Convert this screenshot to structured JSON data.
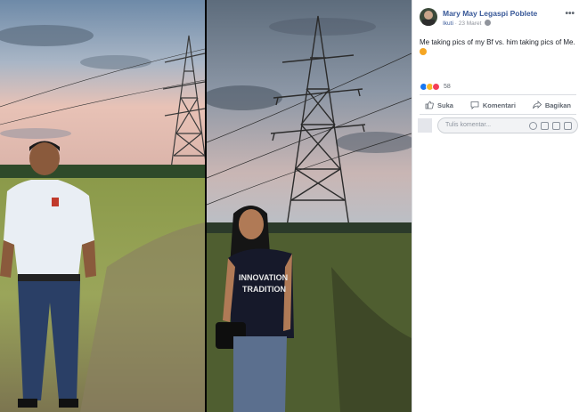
{
  "post": {
    "author": "Mary May Legaspi Poblete",
    "follow": "Ikuti",
    "date": "23 Maret",
    "caption": "Me taking pics of my Bf vs. him taking pics of Me."
  },
  "reactions": {
    "count": "58"
  },
  "actions": {
    "like": "Suka",
    "comment": "Komentari",
    "share": "Bagikan"
  },
  "comment_box": {
    "placeholder": "Tulis komentar..."
  },
  "photo_left": {
    "shirt_text": ""
  },
  "photo_right": {
    "shirt_text_1": "INNOVATION",
    "shirt_text_2": "TRADITION"
  },
  "colors": {
    "fb_blue": "#385898",
    "like_blue": "#1877f2",
    "love_red": "#f33e58",
    "haha_yellow": "#f7b928"
  },
  "icons": [
    "more-icon",
    "globe-icon",
    "like-icon",
    "comment-icon",
    "share-icon",
    "smiley-icon",
    "camera-icon",
    "gif-icon",
    "sticker-icon"
  ]
}
